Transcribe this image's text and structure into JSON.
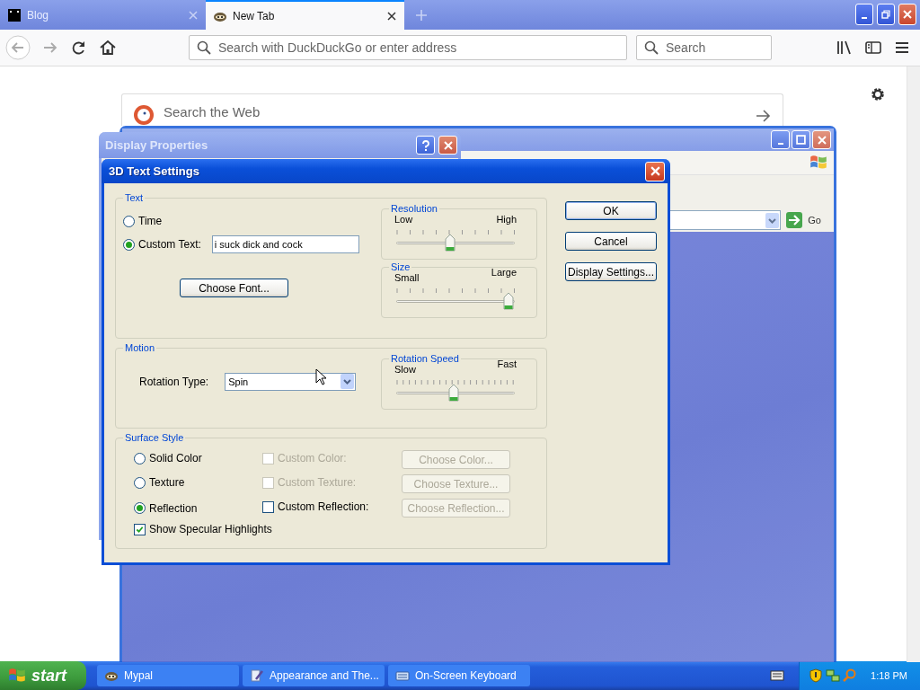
{
  "browser": {
    "tabs": [
      {
        "label": "Blog",
        "selected": false
      },
      {
        "label": "New Tab",
        "selected": true
      }
    ],
    "address": {
      "placeholder": "Search with DuckDuckGo or enter address"
    },
    "search": {
      "placeholder": "Search"
    }
  },
  "page": {
    "search": {
      "placeholder": "Search the Web"
    }
  },
  "background_window": {
    "go_label": "Go"
  },
  "display_properties": {
    "title": "Display Properties"
  },
  "dialog": {
    "title": "3D Text Settings",
    "text_group": {
      "title": "Text",
      "options": [
        {
          "label": "Time",
          "selected": false
        },
        {
          "label": "Custom Text:",
          "selected": true
        }
      ],
      "custom_text": "i suck dick and cock",
      "choose_font": "Choose Font..."
    },
    "sliders": [
      {
        "title": "Resolution",
        "min_label": "Low",
        "max_label": "High",
        "level": 0.45
      },
      {
        "title": "Size",
        "min_label": "Small",
        "max_label": "Large",
        "level": 1.0
      },
      {
        "title": "Rotation Speed",
        "min_label": "Slow",
        "max_label": "Fast",
        "level": 0.48
      }
    ],
    "motion": {
      "title": "Motion",
      "rotation_type_label": "Rotation Type:",
      "rotation_type": "Spin"
    },
    "surface": {
      "title": "Surface Style",
      "rows": [
        {
          "label": "Solid Color",
          "selected": false,
          "option": {
            "label": "Custom Color:",
            "checked": false,
            "disabled": true
          },
          "button": {
            "label": "Choose Color...",
            "disabled": true
          }
        },
        {
          "label": "Texture",
          "selected": false,
          "option": {
            "label": "Custom Texture:",
            "checked": false,
            "disabled": true
          },
          "button": {
            "label": "Choose Texture...",
            "disabled": true
          }
        },
        {
          "label": "Reflection",
          "selected": true,
          "option": {
            "label": "Custom Reflection:",
            "checked": false,
            "disabled": false
          },
          "button": {
            "label": "Choose Reflection...",
            "disabled": true
          }
        }
      ],
      "specular": {
        "label": "Show Specular Highlights",
        "checked": true
      }
    },
    "buttons": [
      "OK",
      "Cancel",
      "Display Settings..."
    ]
  },
  "taskbar": {
    "start": "start",
    "tasks": [
      {
        "label": "Mypal",
        "selected": false
      },
      {
        "label": "Appearance and The...",
        "selected": false
      },
      {
        "label": "On-Screen Keyboard",
        "selected": false
      }
    ],
    "clock": "1:18 PM"
  }
}
